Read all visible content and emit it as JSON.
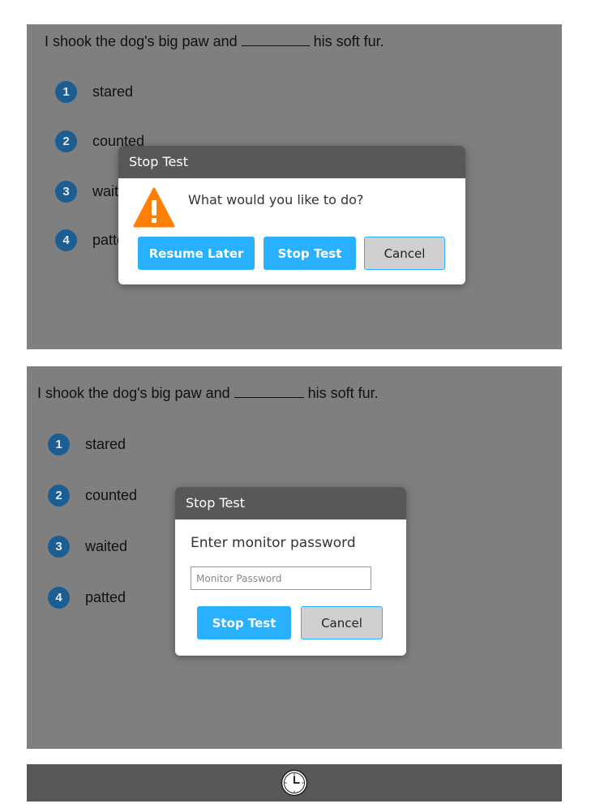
{
  "screen1": {
    "question": {
      "before": "I shook the dog's big paw and",
      "after": "his soft fur."
    },
    "options": [
      {
        "number": "1",
        "label": "stared"
      },
      {
        "number": "2",
        "label": "counted"
      },
      {
        "number": "3",
        "label": "waited"
      },
      {
        "number": "4",
        "label": "patted"
      }
    ],
    "dialog": {
      "title": "Stop Test",
      "message": "What would you like to do?",
      "icon": "warning-icon",
      "buttons": {
        "resume": "Resume Later",
        "stop": "Stop Test",
        "cancel": "Cancel"
      }
    }
  },
  "screen2": {
    "question": {
      "before": "I shook the dog's big paw and",
      "after": "his soft fur."
    },
    "options": [
      {
        "number": "1",
        "label": "stared"
      },
      {
        "number": "2",
        "label": "counted"
      },
      {
        "number": "3",
        "label": "waited"
      },
      {
        "number": "4",
        "label": "patted"
      }
    ],
    "dialog": {
      "title": "Stop Test",
      "message": "Enter monitor password",
      "password": {
        "value": "",
        "placeholder": "Monitor Password"
      },
      "buttons": {
        "stop": "Stop Test",
        "cancel": "Cancel"
      }
    }
  },
  "footer": {
    "icon": "clock-icon"
  },
  "colors": {
    "overlay": "#7f7f7f",
    "header": "#585858",
    "primary_button": "#29b1ff",
    "cancel_button": "#cfcfcf",
    "option_badge": "#1c5e92",
    "warning": "#ff7f00"
  }
}
